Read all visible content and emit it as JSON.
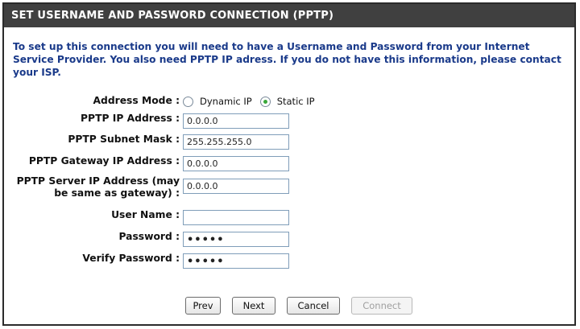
{
  "header": {
    "title": "SET USERNAME AND PASSWORD CONNECTION (PPTP)"
  },
  "intro": "To set up this connection you will need to have a Username and Password from your Internet Service Provider. You also need PPTP IP adress. If you do not have this information, please contact your ISP.",
  "form": {
    "address_mode_label": "Address Mode :",
    "dynamic_label": "Dynamic IP",
    "static_label": "Static IP",
    "address_mode_selected": "Static IP",
    "ip_label": "PPTP IP Address :",
    "ip_value": "0.0.0.0",
    "subnet_label": "PPTP Subnet Mask :",
    "subnet_value": "255.255.255.0",
    "gateway_label": "PPTP Gateway IP Address :",
    "gateway_value": "0.0.0.0",
    "server_label": "PPTP Server IP Address (may be same as gateway) :",
    "server_value": "0.0.0.0",
    "username_label": "User Name :",
    "username_value": "",
    "password_label": "Password :",
    "password_value": "•••••",
    "verify_label": "Verify Password :",
    "verify_value": "•••••"
  },
  "buttons": {
    "prev": "Prev",
    "next": "Next",
    "cancel": "Cancel",
    "connect": "Connect"
  },
  "colors": {
    "header_bg": "#404040",
    "intro_text": "#1a3a8a",
    "radio_selected": "#3aa73a"
  }
}
